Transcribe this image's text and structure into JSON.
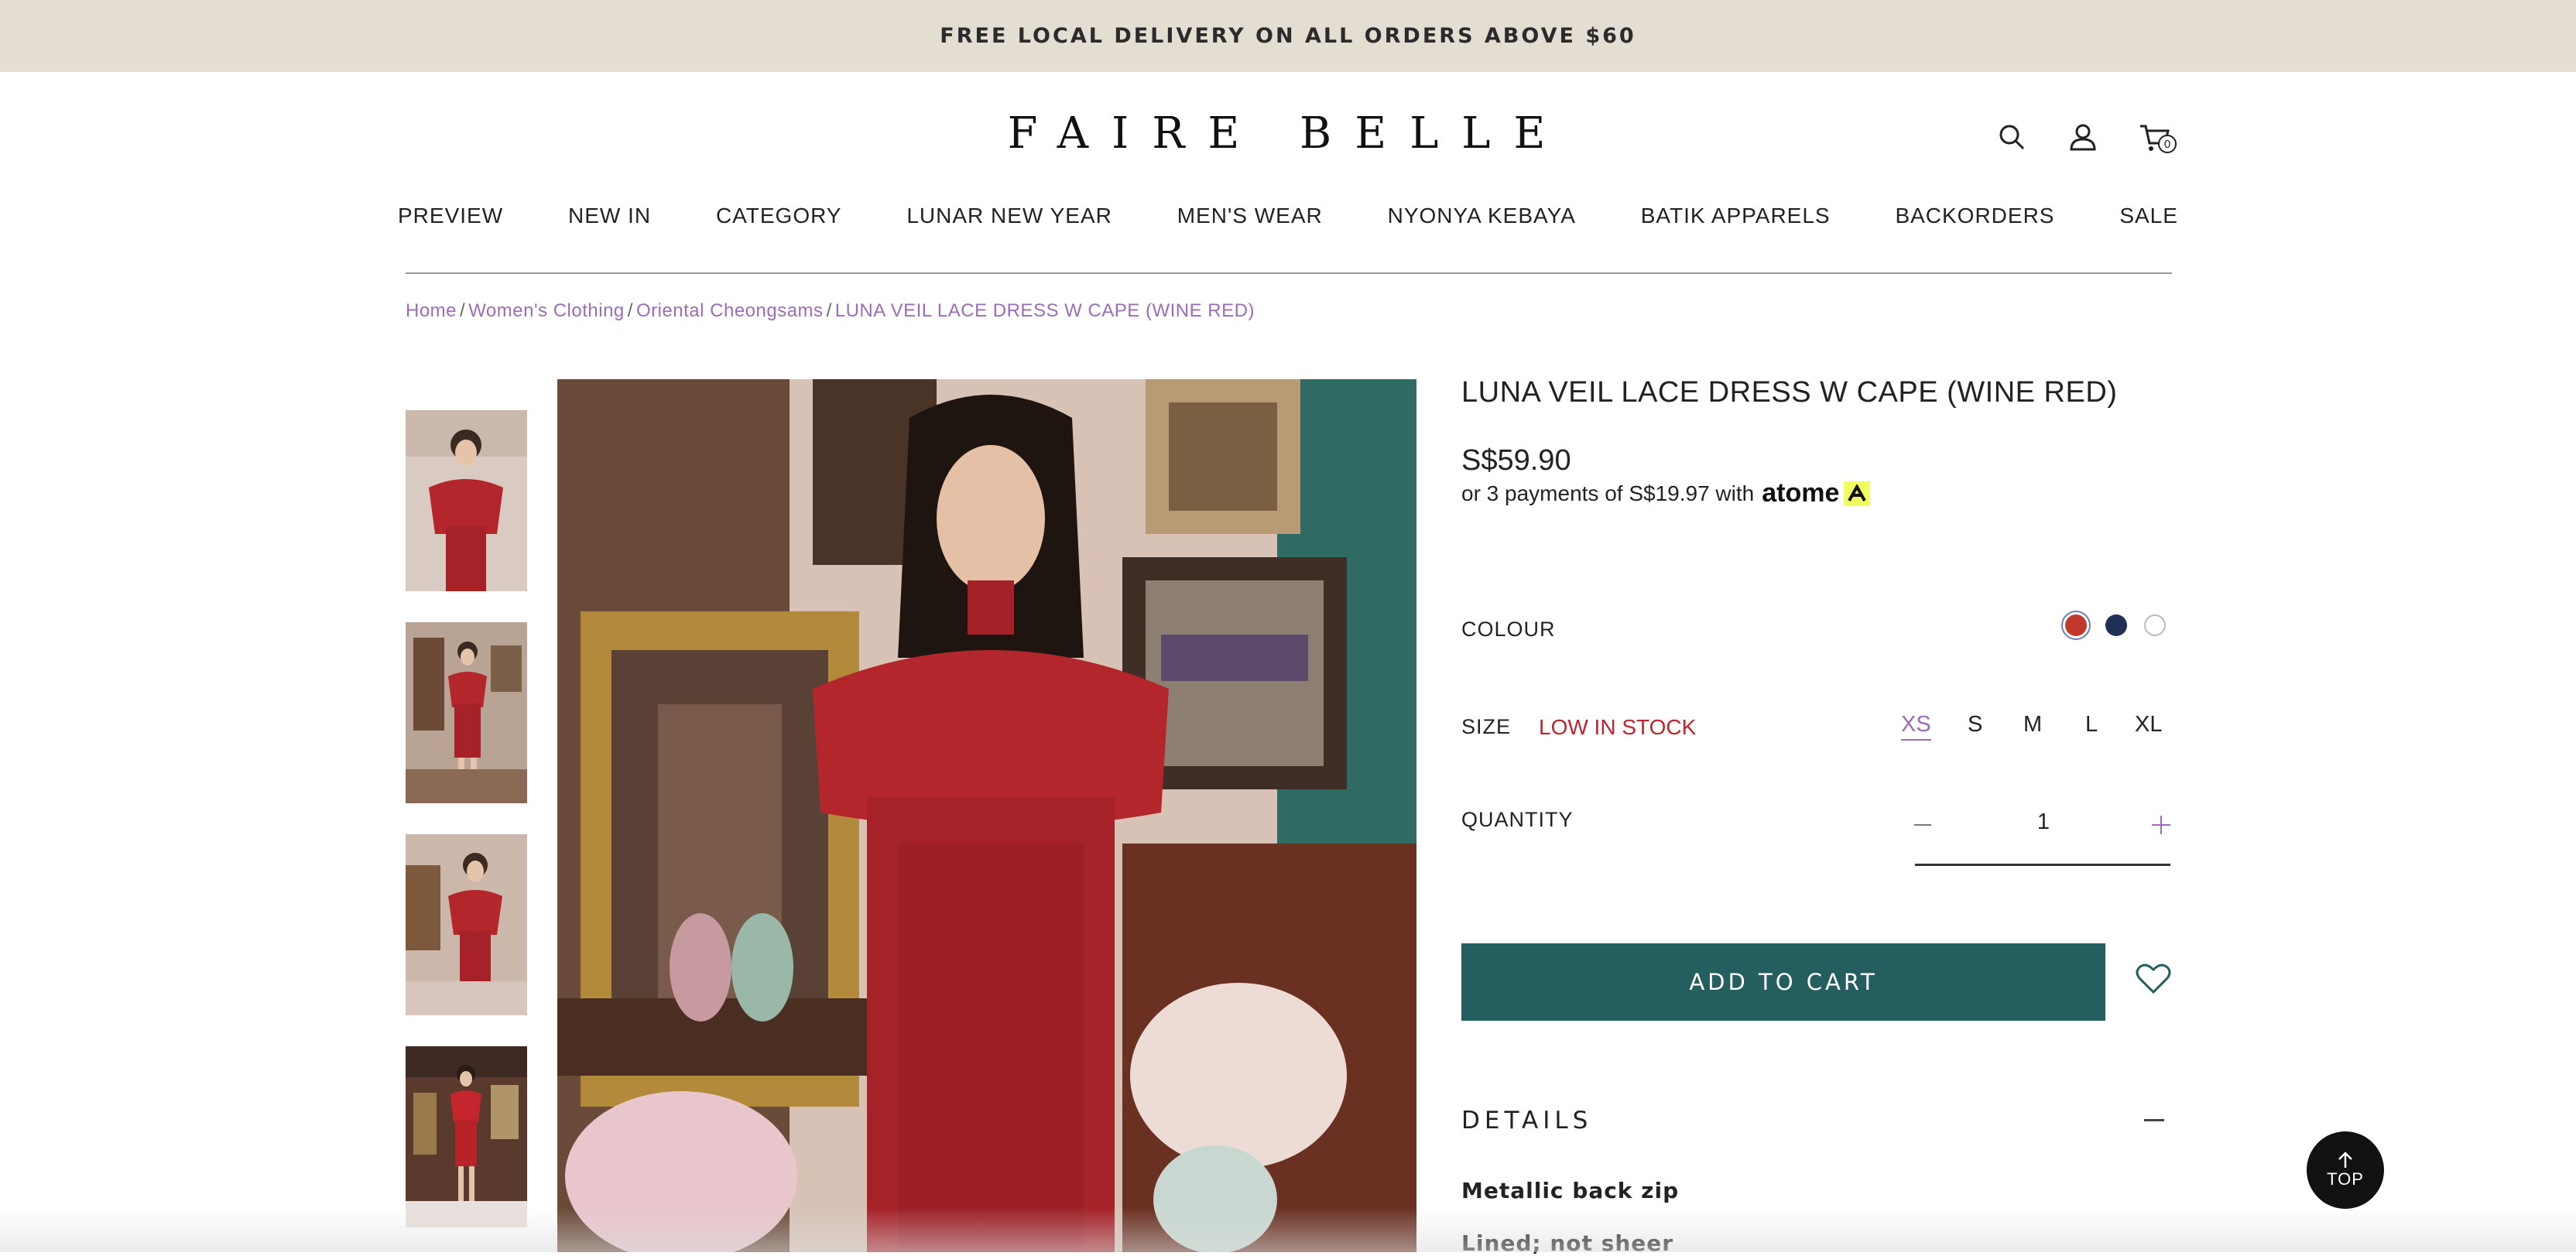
{
  "announcement": "FREE LOCAL DELIVERY ON ALL ORDERS ABOVE $60",
  "brand": "FAIRE BELLE",
  "header": {
    "cart_count": "0"
  },
  "nav": [
    "PREVIEW",
    "NEW IN",
    "CATEGORY",
    "LUNAR NEW YEAR",
    "MEN'S WEAR",
    "NYONYA KEBAYA",
    "BATIK APPARELS",
    "BACKORDERS",
    "SALE"
  ],
  "breadcrumb": [
    "Home",
    "Women's Clothing",
    "Oriental Cheongsams",
    "LUNA VEIL LACE DRESS W CAPE (WINE RED)"
  ],
  "breadcrumb_sep": "/",
  "product": {
    "title": "LUNA VEIL LACE DRESS W CAPE (WINE RED)",
    "price": "S$59.90",
    "installment_text": "or 3 payments of S$19.97 with",
    "installment_brand": "atome",
    "colour_label": "COLOUR",
    "colours": [
      "#c0392b",
      "#1f2f55",
      "#ffffff"
    ],
    "selected_colour": 0,
    "size_label": "SIZE",
    "stock_status": "LOW IN STOCK",
    "sizes": [
      "XS",
      "S",
      "M",
      "L",
      "XL"
    ],
    "selected_size": "XS",
    "quantity_label": "QUANTITY",
    "quantity": "1",
    "add_to_cart": "ADD TO CART",
    "details_heading": "DETAILS",
    "details": [
      "Metallic back zip",
      "Lined; not sheer"
    ]
  },
  "top_button": "TOP",
  "colors": {
    "accent_purple": "#9b6db8",
    "button_teal": "#255e5f",
    "stock_red": "#c0232c",
    "announcement_bg": "#e4ddd2"
  }
}
